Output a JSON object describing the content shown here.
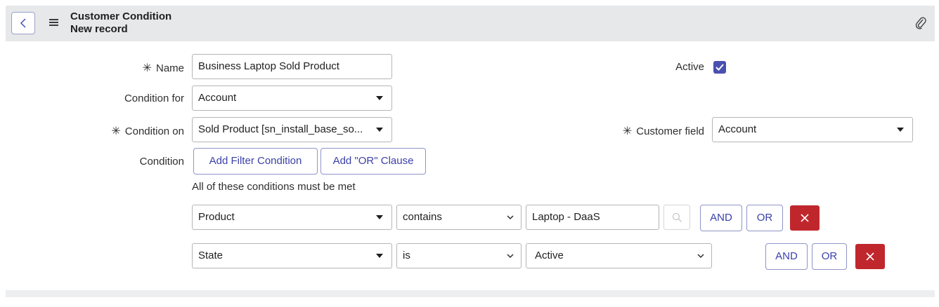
{
  "header": {
    "title": "Customer Condition",
    "subtitle": "New record"
  },
  "icons": {
    "back": "chevron-left-icon",
    "menu": "hamburger-menu-icon",
    "attach": "paperclip-icon",
    "search": "search-icon",
    "remove": "close-icon"
  },
  "form": {
    "name": {
      "label": "Name",
      "required_mark": "✳",
      "value": "Business Laptop Sold Product"
    },
    "active": {
      "label": "Active",
      "checked": true
    },
    "condition_for": {
      "label": "Condition for",
      "value": "Account"
    },
    "condition_on": {
      "label": "Condition on",
      "required_mark": "✳",
      "value": "Sold Product [sn_install_base_so..."
    },
    "customer_field": {
      "label": "Customer field",
      "required_mark": "✳",
      "value": "Account"
    },
    "condition": {
      "label": "Condition",
      "add_filter_label": "Add Filter Condition",
      "add_or_label": "Add \"OR\" Clause",
      "hint": "All of these conditions must be met"
    }
  },
  "conditions": [
    {
      "field": "Product",
      "operator": "contains",
      "value": "Laptop - DaaS",
      "and_label": "AND",
      "or_label": "OR"
    },
    {
      "field": "State",
      "operator": "is",
      "value": "Active",
      "and_label": "AND",
      "or_label": "OR"
    }
  ],
  "colors": {
    "accent": "#4a50b0",
    "danger": "#c0272d",
    "header_bg": "#e6e8ea"
  }
}
